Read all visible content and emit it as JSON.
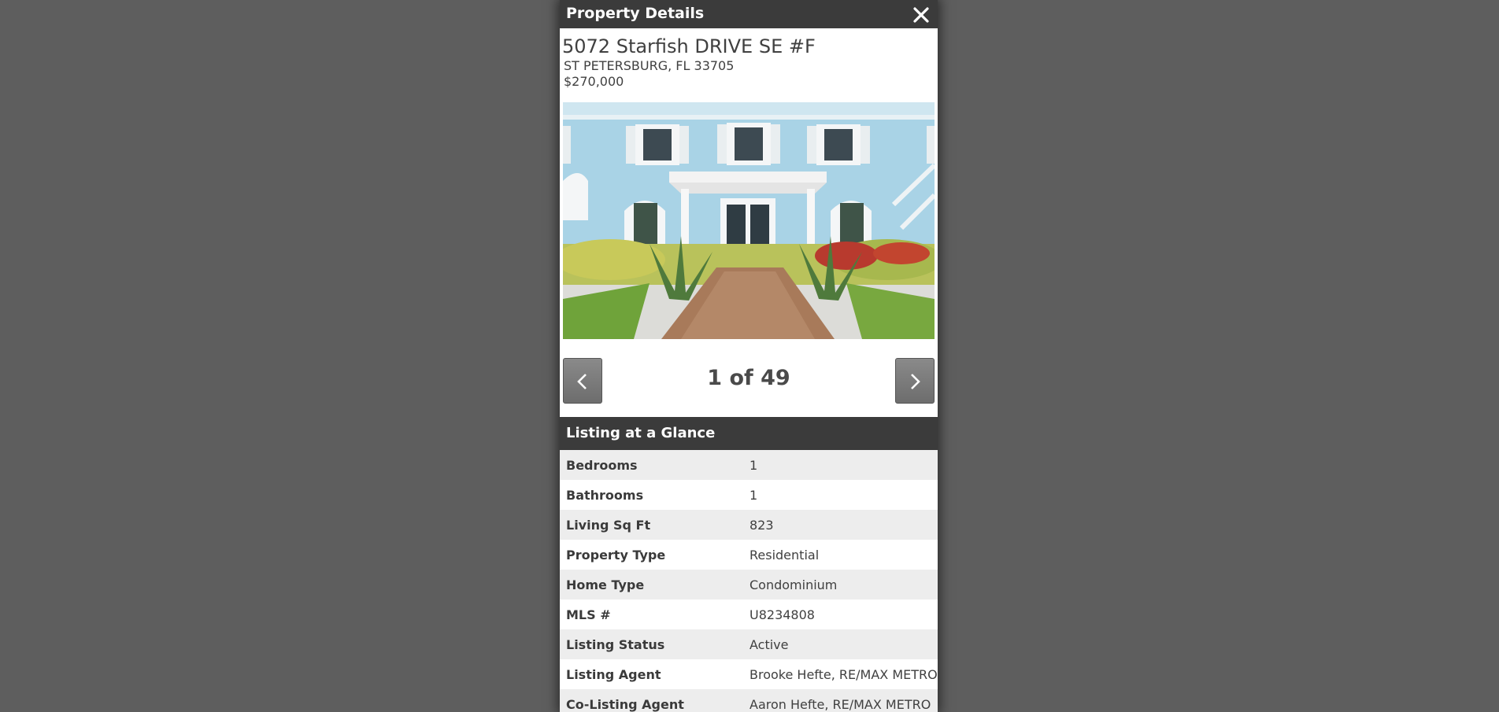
{
  "modal": {
    "title": "Property Details",
    "close_label": "close"
  },
  "property": {
    "street": "5072 Starfish DRIVE SE #F",
    "city_line": "ST PETERSBURG, FL 33705",
    "price": "$270,000"
  },
  "gallery": {
    "counter": "1 of 49",
    "prev_icon": "chevron-left-icon",
    "next_icon": "chevron-right-icon"
  },
  "glance": {
    "heading": "Listing at a Glance",
    "rows": [
      {
        "label": "Bedrooms",
        "value": "1"
      },
      {
        "label": "Bathrooms",
        "value": "1"
      },
      {
        "label": "Living Sq Ft",
        "value": "823"
      },
      {
        "label": "Property Type",
        "value": "Residential"
      },
      {
        "label": "Home Type",
        "value": "Condominium"
      },
      {
        "label": "MLS #",
        "value": "U8234808"
      },
      {
        "label": "Listing Status",
        "value": "Active"
      },
      {
        "label": "Listing Agent",
        "value": "Brooke Hefte, RE/MAX METRO"
      },
      {
        "label": "Co-Listing Agent",
        "value": "Aaron Hefte, RE/MAX METRO"
      }
    ]
  },
  "colors": {
    "backdrop": "#5e5e5e",
    "header": "#3b3b3b",
    "row_alt": "#ededed"
  }
}
